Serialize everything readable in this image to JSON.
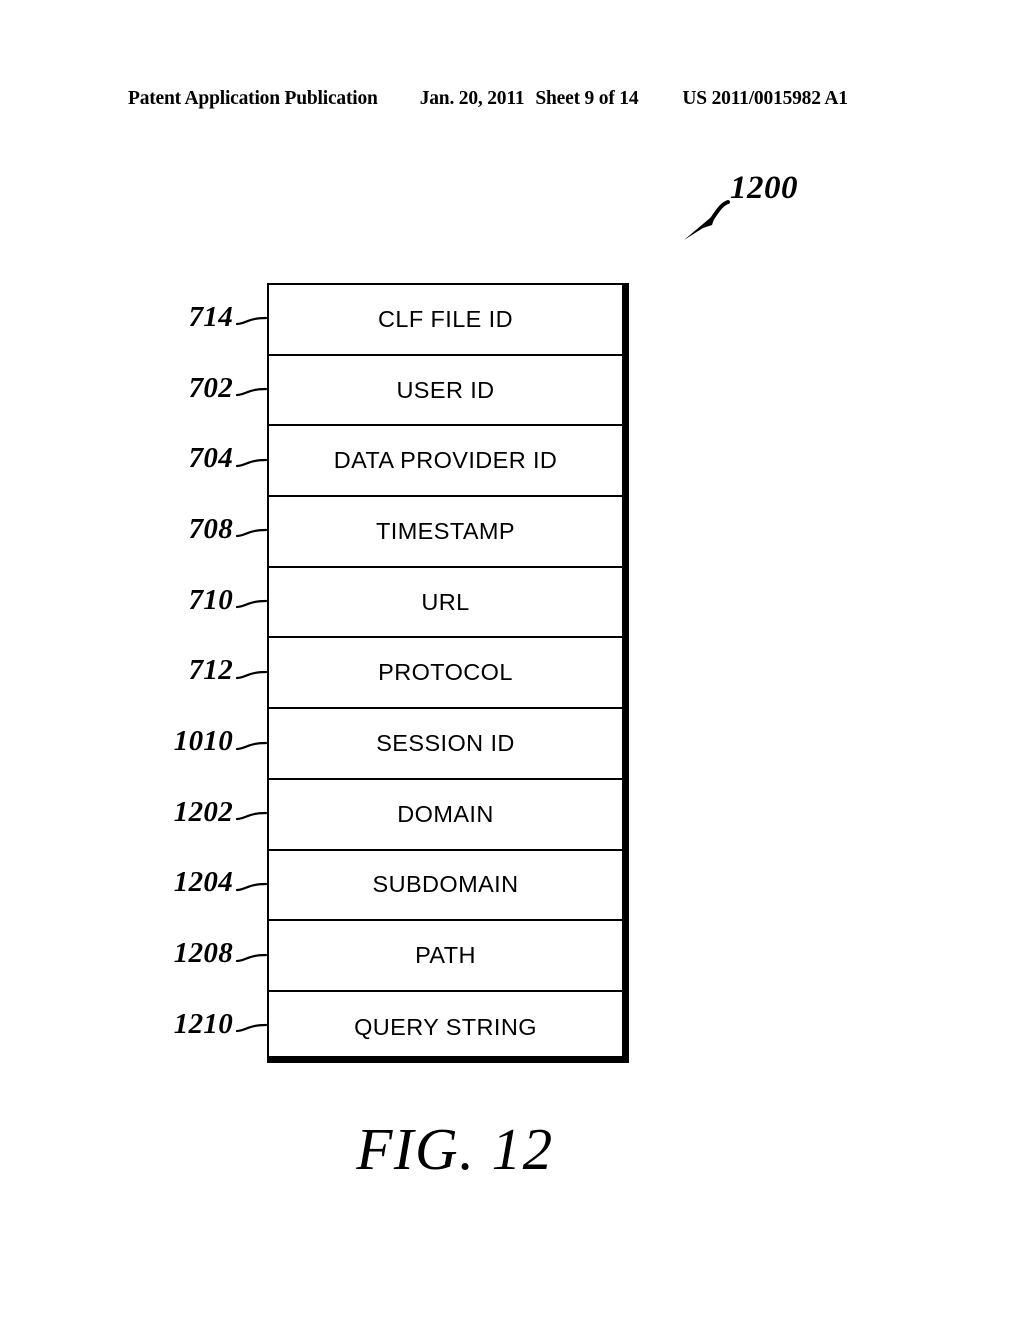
{
  "header": {
    "publication": "Patent Application Publication",
    "date": "Jan. 20, 2011",
    "sheet": "Sheet 9 of 14",
    "patent_number": "US 2011/0015982 A1"
  },
  "figure": {
    "callout_ref": "1200",
    "caption": "FIG. 12"
  },
  "diagram": {
    "rows": [
      {
        "ref": "714",
        "label": "CLF FILE ID"
      },
      {
        "ref": "702",
        "label": "USER ID"
      },
      {
        "ref": "704",
        "label": "DATA PROVIDER ID"
      },
      {
        "ref": "708",
        "label": "TIMESTAMP"
      },
      {
        "ref": "710",
        "label": "URL"
      },
      {
        "ref": "712",
        "label": "PROTOCOL"
      },
      {
        "ref": "1010",
        "label": "SESSION ID"
      },
      {
        "ref": "1202",
        "label": "DOMAIN"
      },
      {
        "ref": "1204",
        "label": "SUBDOMAIN"
      },
      {
        "ref": "1208",
        "label": "PATH"
      },
      {
        "ref": "1210",
        "label": "QUERY STRING"
      }
    ]
  },
  "colors": {
    "ink": "#000000",
    "page": "#ffffff"
  }
}
